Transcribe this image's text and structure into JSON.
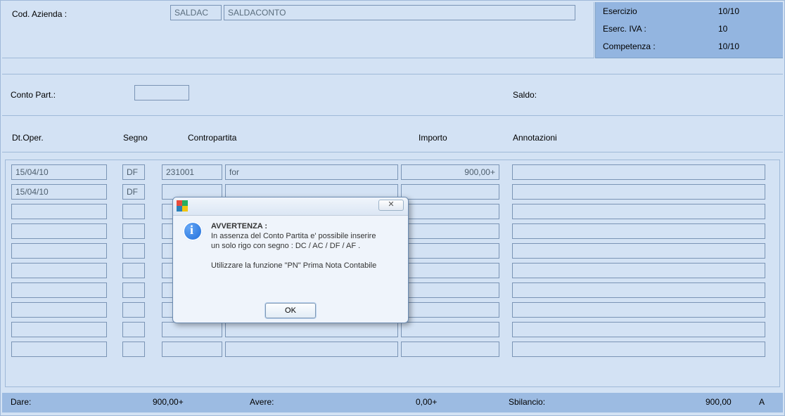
{
  "header": {
    "cod_azienda_label": "Cod. Azienda :",
    "code_field": "SALDAC",
    "name_field": "SALDACONTO"
  },
  "exercise": {
    "esercizio_label": "Esercizio",
    "esercizio_value": "10/10",
    "eserc_iva_label": "Eserc. IVA :",
    "eserc_iva_value": "10",
    "competenza_label": "Competenza :",
    "competenza_value": "10/10"
  },
  "row2": {
    "conto_part_label": "Conto Part.:",
    "conto_part_value": "",
    "saldo_label": "Saldo:"
  },
  "columns": {
    "dt_oper": "Dt.Oper.",
    "segno": "Segno",
    "contropartita": "Contropartita",
    "importo": "Importo",
    "annotazioni": "Annotazioni"
  },
  "rows": [
    {
      "date": "15/04/10",
      "segno": "DF",
      "cp_code": "231001",
      "cp_desc": "for",
      "importo": "900,00+",
      "note": ""
    },
    {
      "date": "15/04/10",
      "segno": "DF",
      "cp_code": "",
      "cp_desc": "",
      "importo": "",
      "note": ""
    },
    {
      "date": "",
      "segno": "",
      "cp_code": "",
      "cp_desc": "",
      "importo": "",
      "note": ""
    },
    {
      "date": "",
      "segno": "",
      "cp_code": "",
      "cp_desc": "",
      "importo": "",
      "note": ""
    },
    {
      "date": "",
      "segno": "",
      "cp_code": "",
      "cp_desc": "",
      "importo": "",
      "note": ""
    },
    {
      "date": "",
      "segno": "",
      "cp_code": "",
      "cp_desc": "",
      "importo": "",
      "note": ""
    },
    {
      "date": "",
      "segno": "",
      "cp_code": "",
      "cp_desc": "",
      "importo": "",
      "note": ""
    },
    {
      "date": "",
      "segno": "",
      "cp_code": "",
      "cp_desc": "",
      "importo": "",
      "note": ""
    },
    {
      "date": "",
      "segno": "",
      "cp_code": "",
      "cp_desc": "",
      "importo": "",
      "note": ""
    },
    {
      "date": "",
      "segno": "",
      "cp_code": "",
      "cp_desc": "",
      "importo": "",
      "note": ""
    }
  ],
  "footer": {
    "dare_label": "Dare:",
    "dare_value": "900,00+",
    "avere_label": "Avere:",
    "avere_value": "0,00+",
    "sbilancio_label": "Sbilancio:",
    "sbilancio_value": "900,00",
    "sbilancio_sign": "A"
  },
  "dialog": {
    "heading": "AVVERTENZA :",
    "line1": "In assenza del Conto Partita e' possibile inserire",
    "line2": "un solo rigo con segno : DC / AC / DF / AF .",
    "line3": "Utilizzare la funzione \"PN\" Prima Nota Contabile",
    "ok": "OK",
    "close_glyph": "✕"
  }
}
